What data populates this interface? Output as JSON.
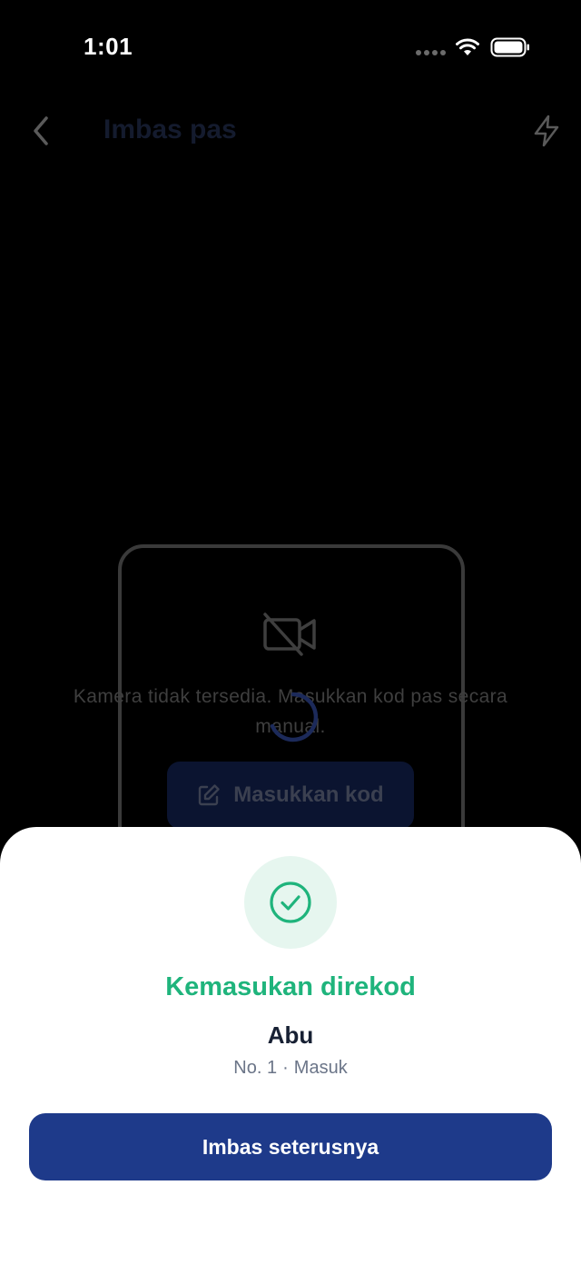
{
  "status_bar": {
    "time": "1:01"
  },
  "header": {
    "title": "Imbas pas"
  },
  "camera": {
    "message": "Kamera tidak tersedia. Masukkan kod pas secara manual.",
    "enter_code_label": "Masukkan kod"
  },
  "result": {
    "title": "Kemasukan direkod",
    "name": "Abu",
    "number": "No. 1",
    "separator": "·",
    "direction": "Masuk",
    "next_button_label": "Imbas seterusnya"
  },
  "colors": {
    "success": "#1fb47c",
    "primary": "#1e3a8a",
    "success_bg": "#e6f6ef"
  },
  "icons": [
    "back-chevron-icon",
    "flash-icon",
    "camera-off-icon",
    "pencil-icon",
    "check-circle-icon",
    "loading-spinner-icon"
  ]
}
